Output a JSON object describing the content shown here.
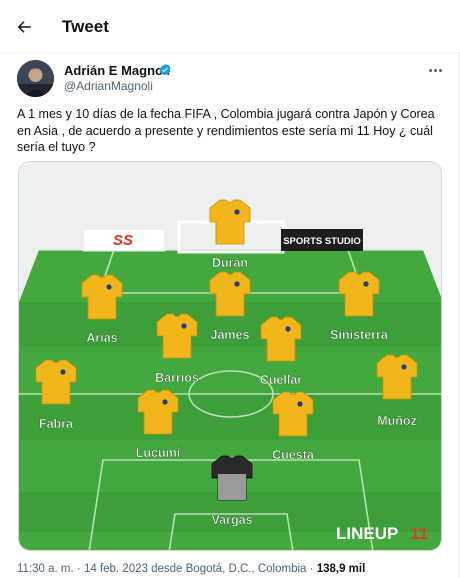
{
  "header": {
    "title": "Tweet",
    "back_icon": "arrow-left-icon"
  },
  "author": {
    "name": "Adrián E Magnoli",
    "handle": "@AdrianMagnoli",
    "verified_icon": "verified-badge-icon",
    "more_icon": "more-horizontal-icon"
  },
  "tweet": {
    "text": "A 1 mes y 10 días de la fecha FIFA , Colombia jugará contra Japón y Corea en Asia , de acuerdo a presente y rendimientos este sería mi 11 Hoy ¿ cuál sería el tuyo ?"
  },
  "media": {
    "sponsor_left_logo": "SS",
    "sponsor_right": "SPORTS STUDIO",
    "watermark": "LINEUP",
    "watermark_num": "11",
    "players": [
      {
        "name": "Durán",
        "kit": "home"
      },
      {
        "name": "Arias",
        "kit": "home"
      },
      {
        "name": "James",
        "kit": "home"
      },
      {
        "name": "Sinisterra",
        "kit": "home"
      },
      {
        "name": "Barrios",
        "kit": "home"
      },
      {
        "name": "Cuellar",
        "kit": "home"
      },
      {
        "name": "Fabra",
        "kit": "home"
      },
      {
        "name": "Muñoz",
        "kit": "home"
      },
      {
        "name": "Lucumí",
        "kit": "home"
      },
      {
        "name": "Cuesta",
        "kit": "home"
      },
      {
        "name": "Vargas",
        "kit": "goalkeeper"
      }
    ],
    "colors": {
      "pitch": "#43a93f",
      "pitch_dark": "#3c9f39",
      "sky": "#eef0ef",
      "kit": "#f2b51a",
      "gk_kit": "#2a2a2a"
    }
  },
  "meta": {
    "time": "11:30 a. m.",
    "date": "14 feb. 2023",
    "source": "desde Bogotá, D.C., Colombia",
    "views": "138,9 mil",
    "sep": "·"
  }
}
